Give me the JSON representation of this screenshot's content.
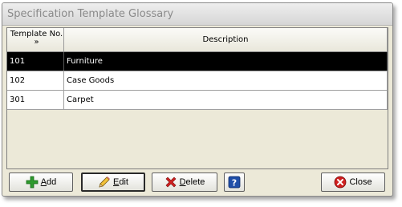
{
  "window": {
    "title": "Specification Template Glossary"
  },
  "grid": {
    "columns": {
      "id_line1": "Template No.",
      "id_sort": "»",
      "description": "Description"
    },
    "rows": [
      {
        "id": "101",
        "description": "Furniture",
        "selected": true
      },
      {
        "id": "102",
        "description": "Case Goods",
        "selected": false
      },
      {
        "id": "301",
        "description": "Carpet",
        "selected": false
      }
    ]
  },
  "buttons": {
    "add": {
      "accel": "A",
      "rest": "dd",
      "icon": "plus-icon"
    },
    "edit": {
      "accel": "E",
      "rest": "dit",
      "icon": "pencil-icon"
    },
    "delete": {
      "accel": "D",
      "rest": "elete",
      "icon": "delete-x-icon"
    },
    "help": {
      "icon": "help-question-icon"
    },
    "close": {
      "label": "Close",
      "icon": "close-circle-icon"
    }
  },
  "colors": {
    "selected_row_bg": "#000000",
    "selected_row_fg": "#ffffff",
    "window_bg": "#ece9d8",
    "plus_icon": "#2e9a2e",
    "delete_icon": "#d02020",
    "help_icon": "#1f4fa8"
  }
}
